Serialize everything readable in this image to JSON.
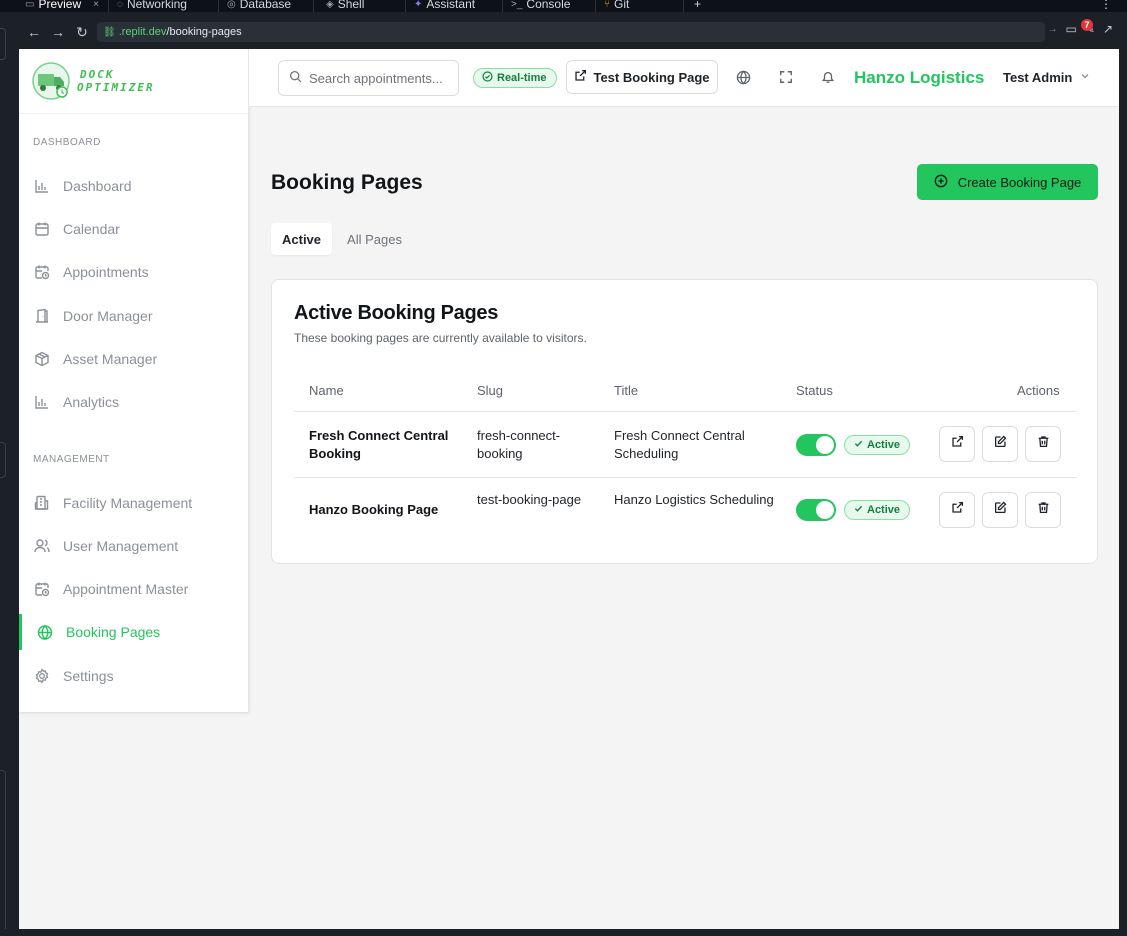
{
  "ide": {
    "tabs": [
      {
        "label": "Preview",
        "icon": "preview-icon"
      },
      {
        "label": "Networking",
        "icon": "networking-icon"
      },
      {
        "label": "Database",
        "icon": "database-icon"
      },
      {
        "label": "Shell",
        "icon": "shell-icon"
      },
      {
        "label": "Assistant",
        "icon": "assistant-icon"
      },
      {
        "label": "Console",
        "icon": "console-icon"
      },
      {
        "label": "Git",
        "icon": "git-icon"
      }
    ],
    "close_glyph": "×",
    "add_glyph": "+",
    "menu_glyph": "⋮",
    "url_host": ".replit.dev",
    "url_path": "/booking-pages",
    "notification_count": "7"
  },
  "sidebar": {
    "logo_line1": "DOCK",
    "logo_line2": "OPTIMIZER",
    "section_dashboard": "DASHBOARD",
    "section_management": "MANAGEMENT",
    "items": [
      {
        "label": "Dashboard",
        "icon": "bar-chart-icon"
      },
      {
        "label": "Calendar",
        "icon": "calendar-icon"
      },
      {
        "label": "Appointments",
        "icon": "calendar-clock-icon"
      },
      {
        "label": "Door Manager",
        "icon": "door-icon"
      },
      {
        "label": "Asset Manager",
        "icon": "package-icon"
      },
      {
        "label": "Analytics",
        "icon": "bar-chart-icon"
      },
      {
        "label": "Facility Management",
        "icon": "building-icon"
      },
      {
        "label": "User Management",
        "icon": "users-icon"
      },
      {
        "label": "Appointment Master",
        "icon": "calendar-clock-icon"
      },
      {
        "label": "Booking Pages",
        "icon": "globe-icon"
      },
      {
        "label": "Settings",
        "icon": "gear-icon"
      }
    ],
    "active_item": "Booking Pages"
  },
  "header": {
    "search_placeholder": "Search appointments...",
    "realtime_label": "Real-time",
    "test_booking_label": "Test Booking Page",
    "org_name": "Hanzo Logistics",
    "user_name": "Test Admin"
  },
  "main": {
    "page_title": "Booking Pages",
    "create_label": "Create Booking Page",
    "tabs": [
      {
        "label": "Active",
        "active": true
      },
      {
        "label": "All Pages",
        "active": false
      }
    ],
    "card_title": "Active Booking Pages",
    "card_subtitle": "These booking pages are currently available to visitors.",
    "columns": [
      "Name",
      "Slug",
      "Title",
      "Status",
      "Actions"
    ],
    "rows": [
      {
        "name": "Fresh Connect Central Booking",
        "slug": "fresh-connect-booking",
        "title": "Fresh Connect Central Scheduling",
        "enabled": true,
        "status": "Active"
      },
      {
        "name": "Hanzo Booking Page",
        "slug": "test-booking-page",
        "title": "Hanzo Logistics Scheduling",
        "enabled": true,
        "status": "Active"
      }
    ]
  },
  "colors": {
    "accent": "#22c55e",
    "accent_dark": "#15803d",
    "badge_bg": "#e7f8ec",
    "page_bg": "#f4f4f4"
  }
}
